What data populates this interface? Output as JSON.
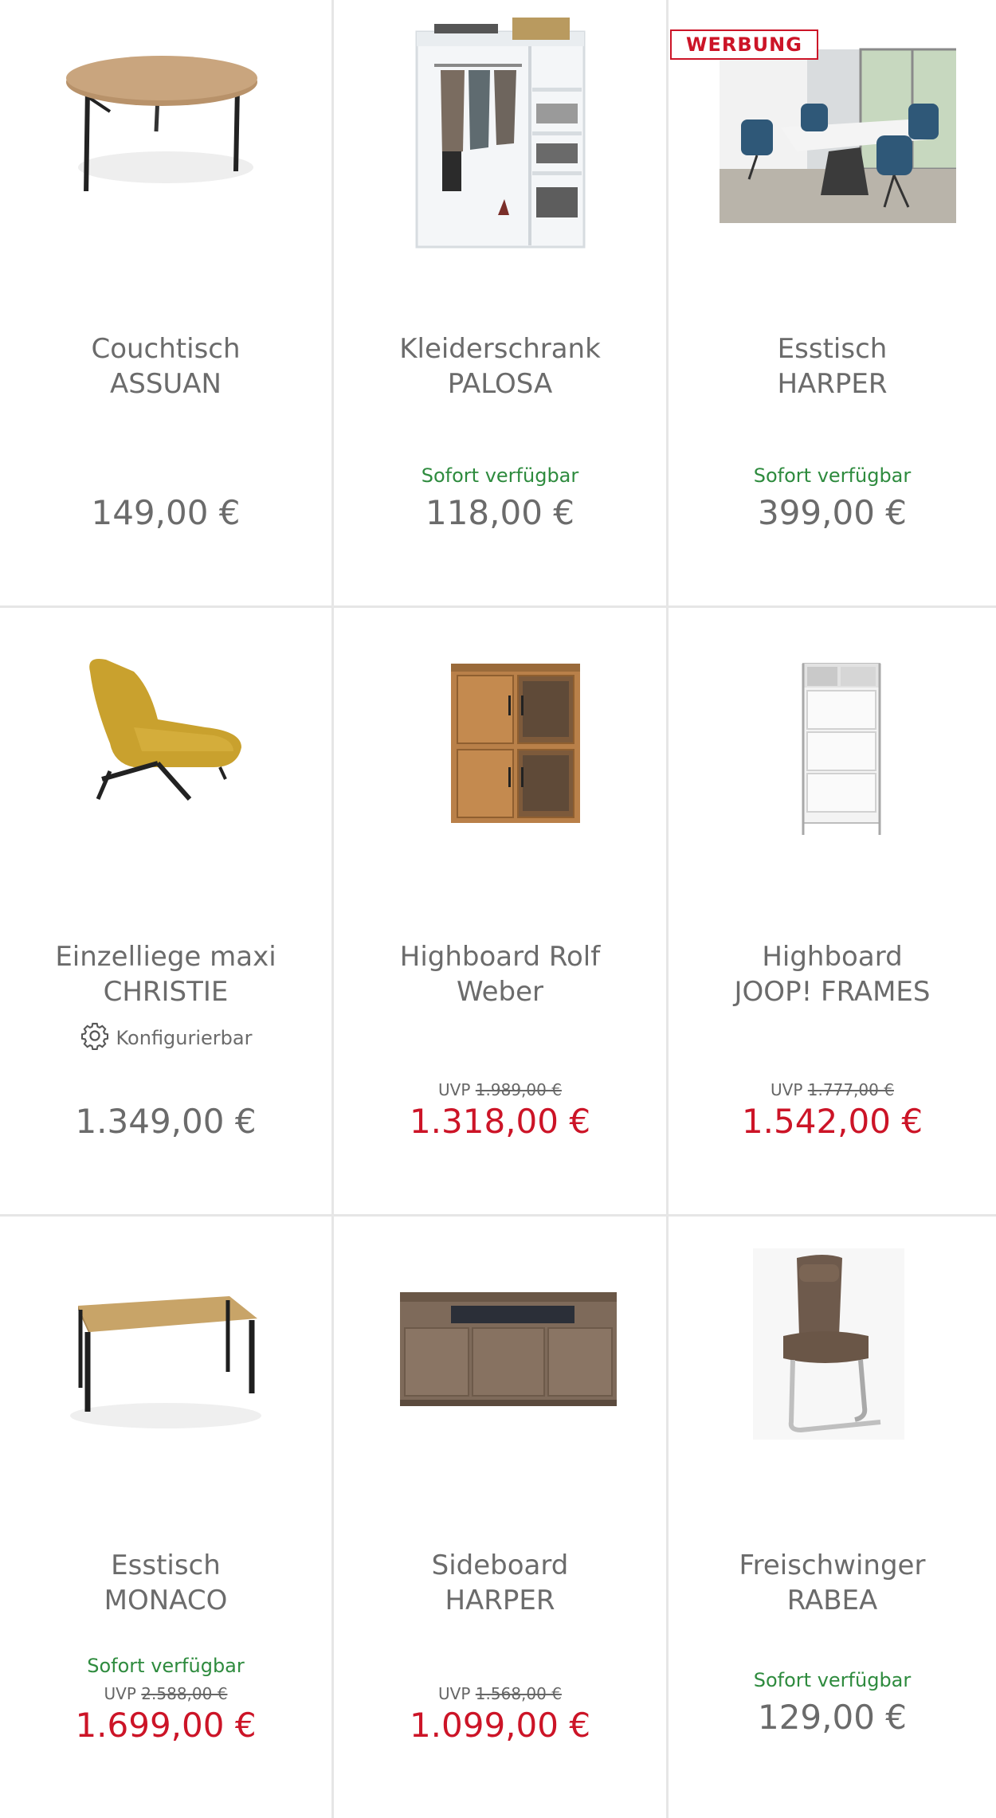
{
  "badge": "WERBUNG",
  "products": [
    {
      "name1": "Couchtisch",
      "name2": "ASSUAN",
      "price": "149,00 €"
    },
    {
      "name1": "Kleiderschrank",
      "name2": "PALOSA",
      "availability": "Sofort verfügbar",
      "price": "118,00 €"
    },
    {
      "name1": "Esstisch",
      "name2": "HARPER",
      "availability": "Sofort verfügbar",
      "price": "399,00 €"
    },
    {
      "name1": "Einzelliege maxi",
      "name2": "CHRISTIE",
      "configurable": "Konfigurierbar",
      "price": "1.349,00 €"
    },
    {
      "name1": "Highboard Rolf",
      "name2": "Weber",
      "uvp_label": "UVP",
      "uvp": "1.989,00 €",
      "price": "1.318,00 €"
    },
    {
      "name1": "Highboard",
      "name2": "JOOP! FRAMES",
      "uvp_label": "UVP",
      "uvp": "1.777,00 €",
      "price": "1.542,00 €"
    },
    {
      "name1": "Esstisch",
      "name2": "MONACO",
      "availability": "Sofort verfügbar",
      "uvp_label": "UVP",
      "uvp": "2.588,00 €",
      "price": "1.699,00 €"
    },
    {
      "name1": "Sideboard",
      "name2": "HARPER",
      "uvp_label": "UVP",
      "uvp": "1.568,00 €",
      "price": "1.099,00 €"
    },
    {
      "name1": "Freischwinger",
      "name2": "RABEA",
      "availability": "Sofort verfügbar",
      "price": "129,00 €"
    }
  ],
  "colors": {
    "sale": "#cc1427",
    "available": "#2e8b3e",
    "text": "#6b6b6b"
  }
}
